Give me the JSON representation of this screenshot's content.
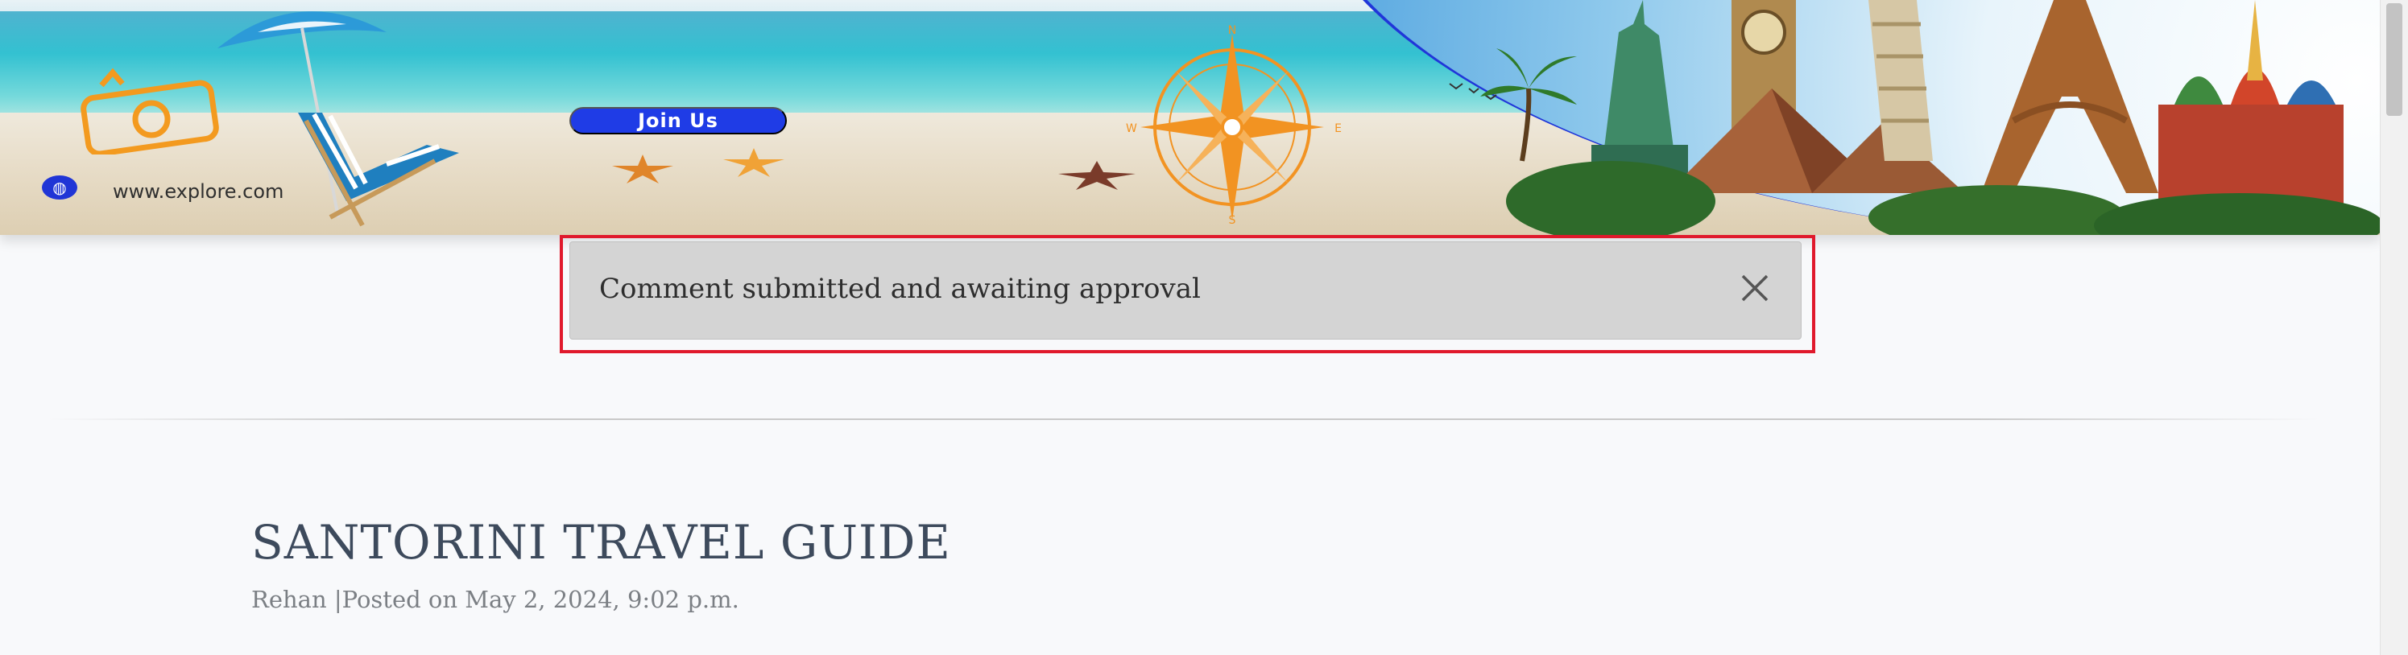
{
  "banner": {
    "join_label": "Join Us",
    "site_url": "www.explore.com",
    "compass_letters": {
      "n": "N",
      "w": "W",
      "e": "E",
      "s": "S"
    }
  },
  "notification": {
    "message": "Comment submitted and awaiting approval",
    "close_icon": "close-icon",
    "highlight_color": "#e0192c"
  },
  "post": {
    "title": "SANTORINI TRAVEL GUIDE",
    "meta": "Rehan |Posted on May 2, 2024, 9:02 p.m."
  },
  "colors": {
    "page_background": "#f8f9fb",
    "notice_background": "#d4d4d4",
    "title_color": "#3d4a5c",
    "join_button": "#1f3ce6"
  }
}
